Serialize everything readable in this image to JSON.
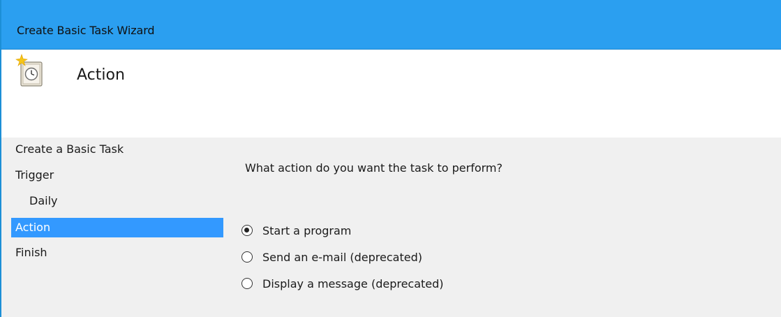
{
  "window": {
    "title": "Create Basic Task Wizard"
  },
  "header": {
    "icon": "scheduled-task-icon",
    "page_title": "Action"
  },
  "steps": [
    {
      "label": "Create a Basic Task",
      "level": 0,
      "active": false
    },
    {
      "label": "Trigger",
      "level": 0,
      "active": false
    },
    {
      "label": "Daily",
      "level": 1,
      "active": false
    },
    {
      "label": "Action",
      "level": 0,
      "active": true
    },
    {
      "label": "Finish",
      "level": 0,
      "active": false
    }
  ],
  "content": {
    "question": "What action do you want the task to perform?",
    "options": [
      {
        "label": "Start a program",
        "selected": true
      },
      {
        "label": "Send an e-mail (deprecated)",
        "selected": false
      },
      {
        "label": "Display a message (deprecated)",
        "selected": false
      }
    ]
  },
  "colors": {
    "titlebar": "#2b9ff0",
    "selection": "#3399ff",
    "panel": "#f0f0f0"
  }
}
